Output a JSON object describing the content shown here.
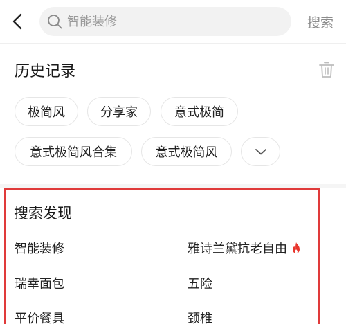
{
  "header": {
    "search_placeholder": "智能装修",
    "search_button": "搜索"
  },
  "history": {
    "title": "历史记录",
    "chips": [
      "极简风",
      "分享家",
      "意式极简",
      "意式极简风合集",
      "意式极简风"
    ]
  },
  "discover": {
    "title": "搜索发现",
    "items": [
      {
        "label": "智能装修",
        "hot": false
      },
      {
        "label": "雅诗兰黛抗老自由",
        "hot": true
      },
      {
        "label": "瑞幸面包",
        "hot": false
      },
      {
        "label": "五险",
        "hot": false
      },
      {
        "label": "平价餐具",
        "hot": false
      },
      {
        "label": "颈椎",
        "hot": false
      }
    ]
  },
  "colors": {
    "highlight_border": "#e03a3a",
    "hot_icon": "#e8362d",
    "chip_border": "#e6e6e6",
    "search_bg": "#f2f2f2"
  },
  "icons": [
    "back-arrow-icon",
    "search-icon",
    "trash-icon",
    "chevron-down-icon",
    "fire-icon"
  ]
}
